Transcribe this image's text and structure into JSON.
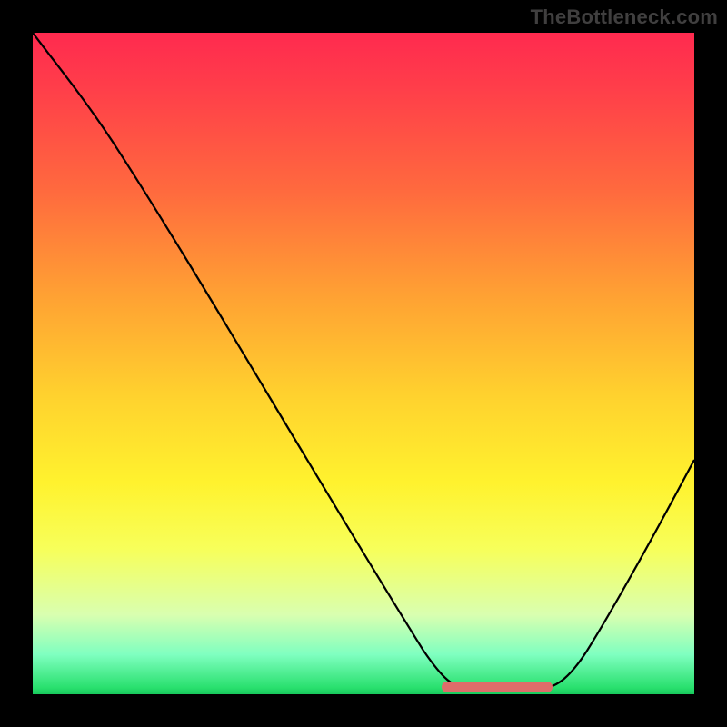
{
  "watermark": "TheBottleneck.com",
  "chart_data": {
    "type": "line",
    "title": "",
    "xlabel": "",
    "ylabel": "",
    "xlim": [
      0,
      100
    ],
    "ylim": [
      0,
      100
    ],
    "grid": false,
    "series": [
      {
        "name": "curve",
        "x": [
          0,
          6,
          12,
          18,
          24,
          30,
          36,
          42,
          48,
          54,
          60,
          63,
          66,
          70,
          74,
          78,
          82,
          86,
          90,
          94,
          100
        ],
        "values": [
          100,
          94,
          87,
          79,
          70,
          60,
          50,
          40,
          30,
          20,
          10,
          5,
          2,
          1,
          1,
          2,
          6,
          12,
          20,
          28,
          42
        ]
      }
    ],
    "highlight": {
      "name": "optimal-flat-segment",
      "x_start": 62,
      "x_end": 78,
      "y": 1
    },
    "background_gradient": {
      "top": "#ff2a4f",
      "mid": "#ffd22e",
      "bottom": "#18c95c"
    }
  }
}
